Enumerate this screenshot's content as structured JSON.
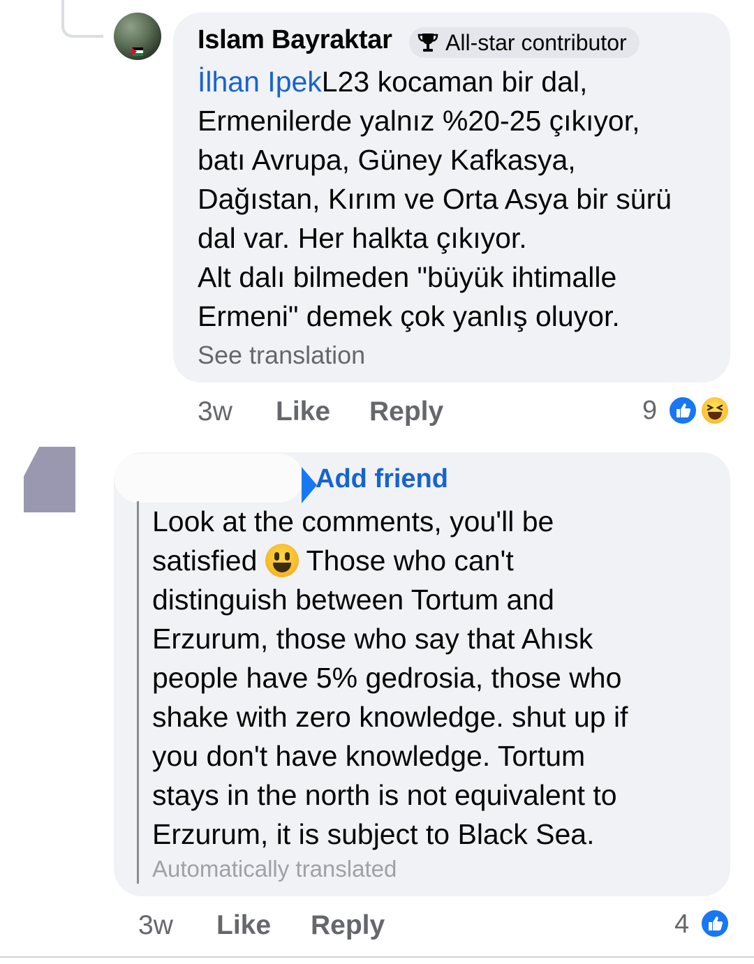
{
  "comment1": {
    "author": "Islam Bayraktar",
    "badge": "All-star contributor",
    "mention": "İlhan Ipek",
    "text": "L23 kocaman bir dal,\nErmenilerde yalnız %20-25 çıkıyor,\nbatı Avrupa, Güney Kafkasya,\nDağıstan, Kırım ve Orta Asya bir sürü\ndal var. Her halkta çıkıyor.\nAlt dalı bilmeden \"büyük ihtimalle\nErmeni\" demek çok yanlış oluyor.",
    "see_translation": "See translation",
    "time": "3w",
    "like": "Like",
    "reply": "Reply",
    "reaction_count": "9"
  },
  "comment2": {
    "add_friend": "Add friend",
    "text_before_emoji": "Look at the comments, you'll be\nsatisfied ",
    "text_after_emoji": " Those who can't\ndistinguish between Tortum and\nErzurum, those who say that Ahısk\npeople have 5% gedrosia, those who\nshake with zero knowledge. shut up if\nyou don't have knowledge. Tortum\nstays in the north is not equivalent to\nErzurum, it is subject to Black Sea.",
    "auto_translated": "Automatically translated",
    "time": "3w",
    "like": "Like",
    "reply": "Reply",
    "reaction_count": "4"
  },
  "colors": {
    "bubble": "#f0f2f5",
    "link": "#1763cf",
    "secondary_text": "#65676b",
    "like_blue": "#1877f2"
  },
  "icons": {
    "badge": "trophy-icon",
    "like_reaction": "like-reaction-icon",
    "haha_reaction": "haha-reaction-icon",
    "emoji": "grinning-face-emoji"
  }
}
